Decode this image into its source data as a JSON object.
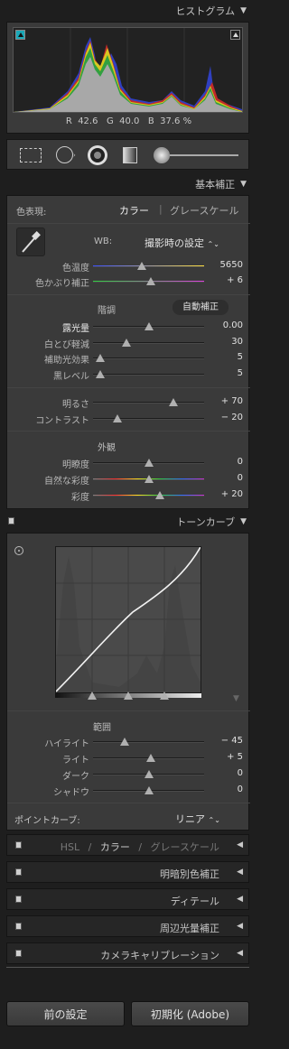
{
  "histogram": {
    "title": "ヒストグラム",
    "readout": {
      "r_label": "R",
      "r_value": "42.6",
      "g_label": "G",
      "g_value": "40.0",
      "b_label": "B",
      "b_value": "37.6",
      "unit": "%"
    }
  },
  "tools": {
    "icons": [
      "crop-overlay-icon",
      "spot-removal-icon",
      "red-eye-icon",
      "graduated-filter-icon",
      "adjustment-brush-icon"
    ]
  },
  "basic": {
    "title": "基本補正",
    "treatment_label": "色表現:",
    "treatment_color": "カラー",
    "treatment_separator": "|",
    "treatment_gray": "グレースケール",
    "wb_label": "WB:",
    "wb_value": "撮影時の設定",
    "wb_arrow": "⌃⌄",
    "temp": {
      "label": "色温度",
      "value": "5650",
      "level": 0.45
    },
    "tint": {
      "label": "色かぶり補正",
      "value": "+ 6",
      "level": 0.52
    },
    "tone_label": "階調",
    "auto_label": "自動補正",
    "exposure": {
      "label": "露光量",
      "value": "0.00",
      "level": 0.5
    },
    "recovery": {
      "label": "白とび軽減",
      "value": "30",
      "level": 0.3
    },
    "fill": {
      "label": "補助光効果",
      "value": "5",
      "level": 0.05
    },
    "blacks": {
      "label": "黒レベル",
      "value": "5",
      "level": 0.05
    },
    "brightness": {
      "label": "明るさ",
      "value": "+ 70",
      "level": 0.72
    },
    "contrast": {
      "label": "コントラスト",
      "value": "− 20",
      "level": 0.22
    },
    "presence_label": "外観",
    "clarity": {
      "label": "明瞭度",
      "value": "0",
      "level": 0.5
    },
    "vibrance": {
      "label": "自然な彩度",
      "value": "0",
      "level": 0.5
    },
    "saturation": {
      "label": "彩度",
      "value": "+ 20",
      "level": 0.6
    }
  },
  "tone_curve": {
    "title": "トーンカーブ",
    "region_label": "範囲",
    "highlights": {
      "label": "ハイライト",
      "value": "− 45",
      "level": 0.28
    },
    "lights": {
      "label": "ライト",
      "value": "+ 5",
      "level": 0.52
    },
    "darks": {
      "label": "ダーク",
      "value": "0",
      "level": 0.5
    },
    "shadows": {
      "label": "シャドウ",
      "value": "0",
      "level": 0.5
    },
    "point_curve_label": "ポイントカーブ:",
    "point_curve_value": "リニア",
    "point_curve_arrow": "⌃⌄"
  },
  "panels": {
    "hsl": {
      "hsl": "HSL",
      "slash1": "/",
      "color": "カラー",
      "slash2": "/",
      "gray": "グレースケール"
    },
    "split_toning": "明暗別色補正",
    "detail": "ディテール",
    "vignettes": "周辺光量補正",
    "camera_calibration": "カメラキャリブレーション"
  },
  "buttons": {
    "previous": "前の設定",
    "reset": "初期化 (Adobe)"
  },
  "icons": {
    "collapse": "▼",
    "expand": "◀"
  },
  "colors": {
    "panel_bg": "#3a3a3a",
    "page_bg": "#1e1e1e",
    "clip_shadow": "#1aa8b8"
  }
}
